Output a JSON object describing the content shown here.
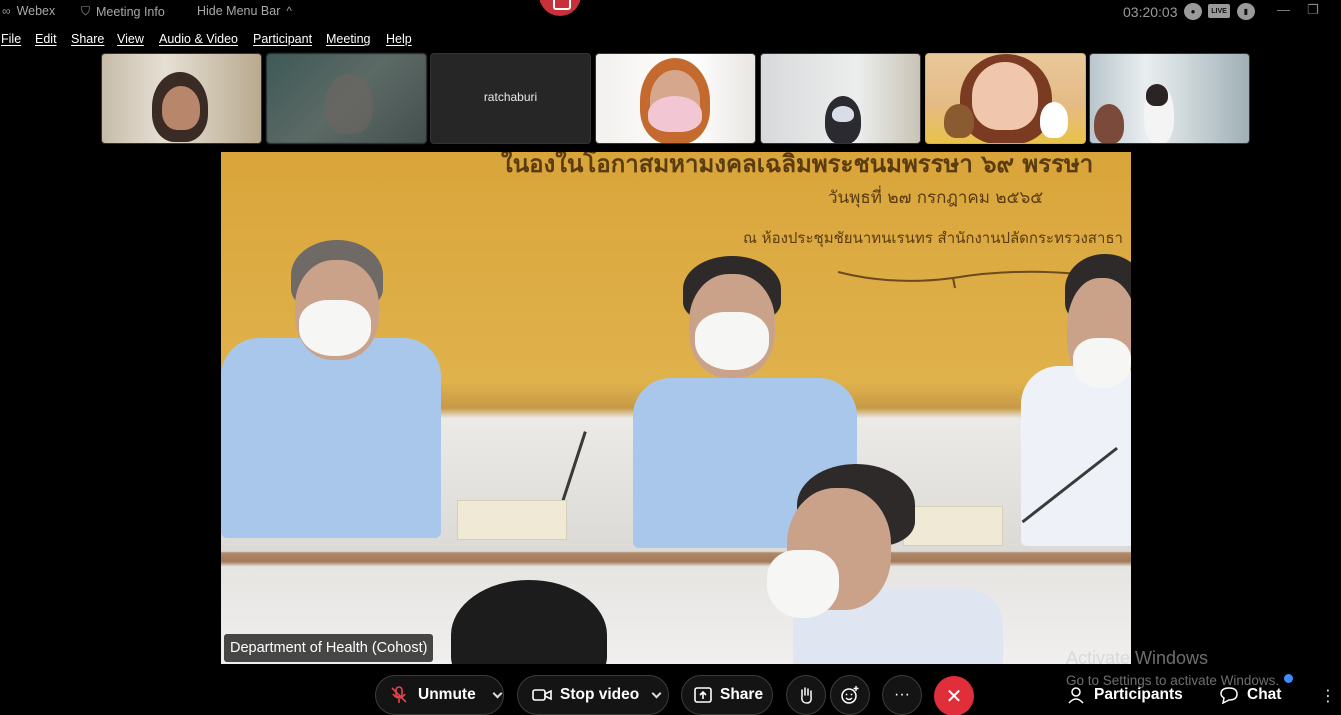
{
  "titlebar": {
    "app_name": "Webex",
    "meeting_info": "Meeting Info",
    "hide_menu_bar": "Hide Menu Bar",
    "hide_menu_bar_chevron": "^",
    "clock": "03:20:03",
    "live_badge": "LIVE",
    "minimize_glyph": "—",
    "restore_glyph": "❐"
  },
  "menu": {
    "items": [
      "File",
      "Edit",
      "Share",
      "View",
      "Audio & Video",
      "Participant",
      "Meeting",
      "Help"
    ]
  },
  "thumbnails": [
    {
      "name": ""
    },
    {
      "name": ""
    },
    {
      "name": "ratchaburi"
    },
    {
      "name": ""
    },
    {
      "name": ""
    },
    {
      "name": ""
    },
    {
      "name": ""
    }
  ],
  "main_video": {
    "banner_line1": "ในองในโอกาสมหามงคลเฉลิมพระชนมพรรษา ๖๙ พรรษา",
    "banner_line2": "วันพุธที่ ๒๗ กรกฎาคม ๒๕๖๕",
    "banner_line3": "ณ ห้องประชุมชัยนาทนเรนทร สำนักงานปลัดกระทรวงสาธา",
    "speaker_name": "Department of Health (Cohost)"
  },
  "watermark": {
    "title": "Activate Windows",
    "subtitle": "Go to Settings to activate Windows."
  },
  "controls": {
    "unmute_label": "Unmute",
    "stop_video_label": "Stop video",
    "share_label": "Share",
    "more_glyph": "···",
    "leave_glyph": "✕",
    "participants_label": "Participants",
    "chat_label": "Chat",
    "chat_more_glyph": "⋮"
  }
}
